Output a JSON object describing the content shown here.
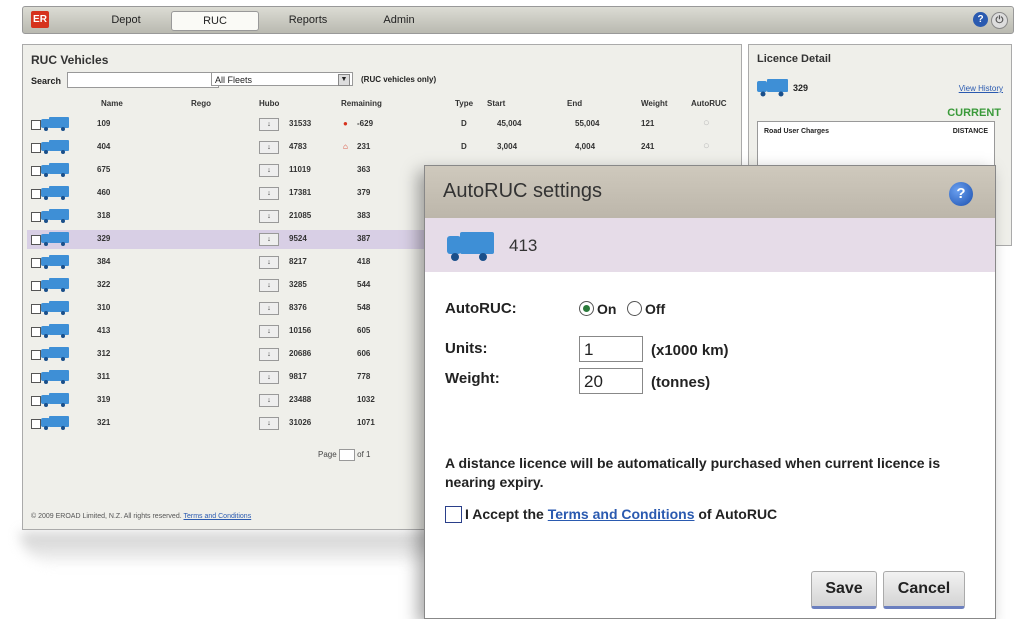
{
  "nav": {
    "logo": "ER",
    "tabs": [
      "Depot",
      "RUC",
      "Reports",
      "Admin"
    ],
    "active_tab": "RUC"
  },
  "vehicles": {
    "title": "RUC Vehicles",
    "search_label": "Search",
    "fleet_select": "All Fleets",
    "filter_label": "(RUC vehicles only)",
    "columns": [
      "Name",
      "Rego",
      "Hubo",
      "Remaining",
      "Type",
      "Start",
      "End",
      "Weight",
      "AutoRUC"
    ],
    "rows": [
      {
        "name": "109",
        "hubo": "31533",
        "remaining": "-629",
        "type": "D",
        "start": "45,004",
        "end": "55,004",
        "weight": "121"
      },
      {
        "name": "404",
        "hubo": "4783",
        "remaining": "231",
        "type": "D",
        "start": "3,004",
        "end": "4,004",
        "weight": "241"
      },
      {
        "name": "675",
        "hubo": "11019",
        "remaining": "363",
        "type": "",
        "start": "",
        "end": "",
        "weight": ""
      },
      {
        "name": "460",
        "hubo": "17381",
        "remaining": "379",
        "type": "",
        "start": "",
        "end": "",
        "weight": ""
      },
      {
        "name": "318",
        "hubo": "21085",
        "remaining": "383",
        "type": "",
        "start": "",
        "end": "",
        "weight": ""
      },
      {
        "name": "329",
        "hubo": "9524",
        "remaining": "387",
        "type": "",
        "start": "",
        "end": "",
        "weight": ""
      },
      {
        "name": "384",
        "hubo": "8217",
        "remaining": "418",
        "type": "",
        "start": "",
        "end": "",
        "weight": ""
      },
      {
        "name": "322",
        "hubo": "3285",
        "remaining": "544",
        "type": "",
        "start": "",
        "end": "",
        "weight": ""
      },
      {
        "name": "310",
        "hubo": "8376",
        "remaining": "548",
        "type": "",
        "start": "",
        "end": "",
        "weight": ""
      },
      {
        "name": "413",
        "hubo": "10156",
        "remaining": "605",
        "type": "",
        "start": "",
        "end": "",
        "weight": ""
      },
      {
        "name": "312",
        "hubo": "20686",
        "remaining": "606",
        "type": "",
        "start": "",
        "end": "",
        "weight": ""
      },
      {
        "name": "311",
        "hubo": "9817",
        "remaining": "778",
        "type": "",
        "start": "",
        "end": "",
        "weight": ""
      },
      {
        "name": "319",
        "hubo": "23488",
        "remaining": "1032",
        "type": "",
        "start": "",
        "end": "",
        "weight": ""
      },
      {
        "name": "321",
        "hubo": "31026",
        "remaining": "1071",
        "type": "",
        "start": "",
        "end": "",
        "weight": ""
      }
    ],
    "pager": {
      "label": "Page",
      "page": "1",
      "of": "of 1"
    },
    "footer_text": "© 2009 EROAD Limited, N.Z. All rights reserved.",
    "footer_link": "Terms and Conditions"
  },
  "licence": {
    "title": "Licence Detail",
    "vehicle": "329",
    "view_link": "View History",
    "status": "CURRENT",
    "card_left": "Road User Charges",
    "card_right": "DISTANCE"
  },
  "dialog": {
    "title": "AutoRUC settings",
    "vehicle": "413",
    "autoruc_label": "AutoRUC:",
    "on_label": "On",
    "off_label": "Off",
    "autoruc_on": true,
    "units_label": "Units:",
    "units_value": "1",
    "units_unit": "(x1000 km)",
    "weight_label": "Weight:",
    "weight_value": "20",
    "weight_unit": "(tonnes)",
    "notice": "A distance licence will be automatically purchased when current licence is nearing expiry.",
    "accept_prefix": "I Accept the ",
    "accept_link": "Terms and Conditions",
    "accept_suffix": " of AutoRUC",
    "save_label": "Save",
    "cancel_label": "Cancel"
  },
  "colors": {
    "selected_row": "#d8cfe5",
    "truck": "#3e8fd6",
    "link": "#2a5ab0",
    "current": "#3a9a3a",
    "alert": "#d6321d"
  }
}
